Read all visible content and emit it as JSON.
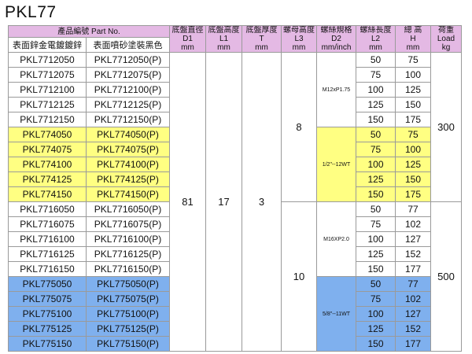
{
  "title": "PKL77",
  "headers": {
    "part_no": "產品編號 Part No.",
    "col_plated": "表面鋅金電鍍鍍鋅",
    "col_painted": "表面噴砂塗裝黑色",
    "d1": [
      "底盤直徑",
      "D1",
      "mm"
    ],
    "l1": [
      "底盤高度",
      "L1",
      "mm"
    ],
    "t": [
      "底盤厚度",
      "T",
      "mm"
    ],
    "l3": [
      "螺母高度",
      "L3",
      "mm"
    ],
    "d2": [
      "螺絲規格",
      "D2",
      "mm/inch"
    ],
    "l2": [
      "螺絲長度",
      "L2",
      "mm"
    ],
    "h": [
      "總 高",
      "H",
      "mm"
    ],
    "load": [
      "荷重",
      "Load",
      "kg"
    ]
  },
  "shared": {
    "d1": "81",
    "l1": "17",
    "t": "3"
  },
  "groups": [
    {
      "color": "white",
      "l3": "8",
      "d2": "M12xP1.75",
      "load": "300",
      "rows": [
        [
          "PKL7712050",
          "PKL7712050(P)",
          "50",
          "75"
        ],
        [
          "PKL7712075",
          "PKL7712075(P)",
          "75",
          "100"
        ],
        [
          "PKL7712100",
          "PKL7712100(P)",
          "100",
          "125"
        ],
        [
          "PKL7712125",
          "PKL7712125(P)",
          "125",
          "150"
        ],
        [
          "PKL7712150",
          "PKL7712150(P)",
          "150",
          "175"
        ]
      ]
    },
    {
      "color": "yellow",
      "l3": "",
      "d2": "1/2\"--12WT",
      "load": "",
      "rows": [
        [
          "PKL774050",
          "PKL774050(P)",
          "50",
          "75"
        ],
        [
          "PKL774075",
          "PKL774075(P)",
          "75",
          "100"
        ],
        [
          "PKL774100",
          "PKL774100(P)",
          "100",
          "125"
        ],
        [
          "PKL774125",
          "PKL774125(P)",
          "125",
          "150"
        ],
        [
          "PKL774150",
          "PKL774150(P)",
          "150",
          "175"
        ]
      ]
    },
    {
      "color": "white",
      "l3": "10",
      "d2": "M16XP2.0",
      "load": "500",
      "rows": [
        [
          "PKL7716050",
          "PKL7716050(P)",
          "50",
          "77"
        ],
        [
          "PKL7716075",
          "PKL7716075(P)",
          "75",
          "102"
        ],
        [
          "PKL7716100",
          "PKL7716100(P)",
          "100",
          "127"
        ],
        [
          "PKL7716125",
          "PKL7716125(P)",
          "125",
          "152"
        ],
        [
          "PKL7716150",
          "PKL7716150(P)",
          "150",
          "177"
        ]
      ]
    },
    {
      "color": "blue",
      "l3": "",
      "d2": "5/8\"--11WT",
      "load": "",
      "rows": [
        [
          "PKL775050",
          "PKL775050(P)",
          "50",
          "77"
        ],
        [
          "PKL775075",
          "PKL775075(P)",
          "75",
          "102"
        ],
        [
          "PKL775100",
          "PKL775100(P)",
          "100",
          "127"
        ],
        [
          "PKL775125",
          "PKL775125(P)",
          "125",
          "152"
        ],
        [
          "PKL775150",
          "PKL775150(P)",
          "150",
          "177"
        ]
      ]
    }
  ],
  "colors": {
    "header": "#e4b9e4",
    "yellow": "#ffff82",
    "blue": "#7fb0ee"
  }
}
